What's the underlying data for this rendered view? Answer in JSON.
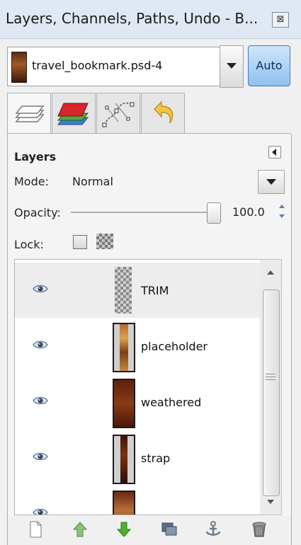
{
  "window": {
    "title": "Layers, Channels, Paths, Undo - B...",
    "close_symbol": "⊠"
  },
  "image_selector": {
    "value": "travel_bookmark.psd-4",
    "auto_label": "Auto"
  },
  "tabs": [
    {
      "icon": "layers-icon",
      "active": true
    },
    {
      "icon": "channels-icon",
      "active": false
    },
    {
      "icon": "paths-icon",
      "active": false
    },
    {
      "icon": "undo-icon",
      "active": false
    }
  ],
  "layers_panel": {
    "heading": "Layers",
    "mode_label": "Mode:",
    "mode_value": "Normal",
    "opacity_label": "Opacity:",
    "opacity_value": "100.0",
    "opacity_fraction": 1.0,
    "lock_label": "Lock:"
  },
  "layers": [
    {
      "name": "TRIM",
      "visible": true,
      "selected": true
    },
    {
      "name": "placeholder",
      "visible": true,
      "selected": false
    },
    {
      "name": "weathered",
      "visible": true,
      "selected": false
    },
    {
      "name": "strap",
      "visible": true,
      "selected": false
    },
    {
      "name": "",
      "visible": true,
      "selected": false
    }
  ],
  "toolbar": [
    "new-layer-icon",
    "raise-layer-icon",
    "lower-layer-icon",
    "duplicate-layer-icon",
    "anchor-layer-icon",
    "delete-layer-icon"
  ],
  "colors": {
    "title_bar": "#dfe8f3",
    "auto_button": "#8fc1ef",
    "raise_arrow": "#6fae4f",
    "lower_arrow": "#3f9a2c"
  }
}
